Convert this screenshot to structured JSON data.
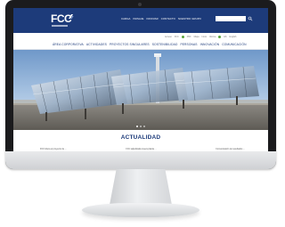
{
  "site": {
    "logo_text": "FCC",
    "accent_color": "#1d3b7a",
    "header_links": [
      "CARGA",
      "PAISAJE",
      "INNOVAR",
      "CONTACTO",
      "NUESTRO GRUPO"
    ],
    "search": {
      "value": "",
      "placeholder": ""
    },
    "utility_links": [
      "Acceso",
      "FCC",
      "PDF",
      "Mapa",
      "Inicio",
      "Idioma",
      "ES",
      "English"
    ],
    "main_nav": [
      "ÁREA CORPORATIVA",
      "ACTIVIDADES",
      "PROYECTOS SINGULARES",
      "SOSTENIBILIDAD",
      "PERSONAS",
      "INNOVACIÓN",
      "COMUNICACIÓN"
    ],
    "hero": {
      "image": "solar-thermal-plant-photo"
    },
    "section_title": "ACTUALIDAD",
    "news_items": [
      "FCC lidera el proyecto de ...",
      "FCC adjudicada nueva planta ...",
      "Comunicación de resultados ..."
    ]
  },
  "icons": {
    "camera": "webcam-dot-icon",
    "search": "search-icon",
    "logo_mark": "fcc-logo-mark-icon"
  }
}
